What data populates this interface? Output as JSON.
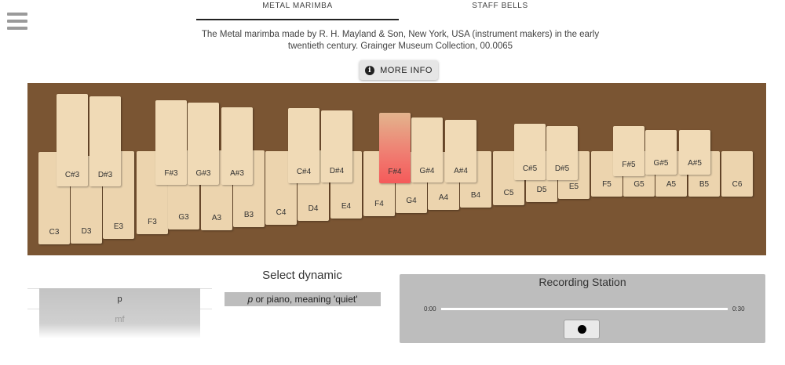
{
  "tabs": [
    {
      "label": "METAL MARIMBA",
      "active": true
    },
    {
      "label": "STAFF BELLS",
      "active": false
    }
  ],
  "description": "The Metal marimba made by R. H. Mayland & Son, New York, USA (instrument makers) in the early twentieth century. Grainger Museum Collection, 00.0065",
  "more_info_label": "MORE INFO",
  "keyboard": {
    "naturals": [
      "C3",
      "D3",
      "E3",
      "F3",
      "G3",
      "A3",
      "B3",
      "C4",
      "D4",
      "E4",
      "F4",
      "G4",
      "A4",
      "B4",
      "C5",
      "D5",
      "E5",
      "F5",
      "G5",
      "A5",
      "B5",
      "C6"
    ],
    "sharps": [
      "C#3",
      "D#3",
      "F#3",
      "G#3",
      "A#3",
      "C#4",
      "D#4",
      "F#4",
      "G#4",
      "A#4",
      "C#5",
      "D#5",
      "F#5",
      "G#5",
      "A#5"
    ],
    "active_note": "F#4"
  },
  "dynamics": {
    "title": "Select dynamic",
    "selected_description": "p or piano, meaning 'quiet'",
    "options": [
      "p",
      "mf"
    ]
  },
  "recording": {
    "title": "Recording Station",
    "start_time": "0:00",
    "end_time": "0:30"
  }
}
